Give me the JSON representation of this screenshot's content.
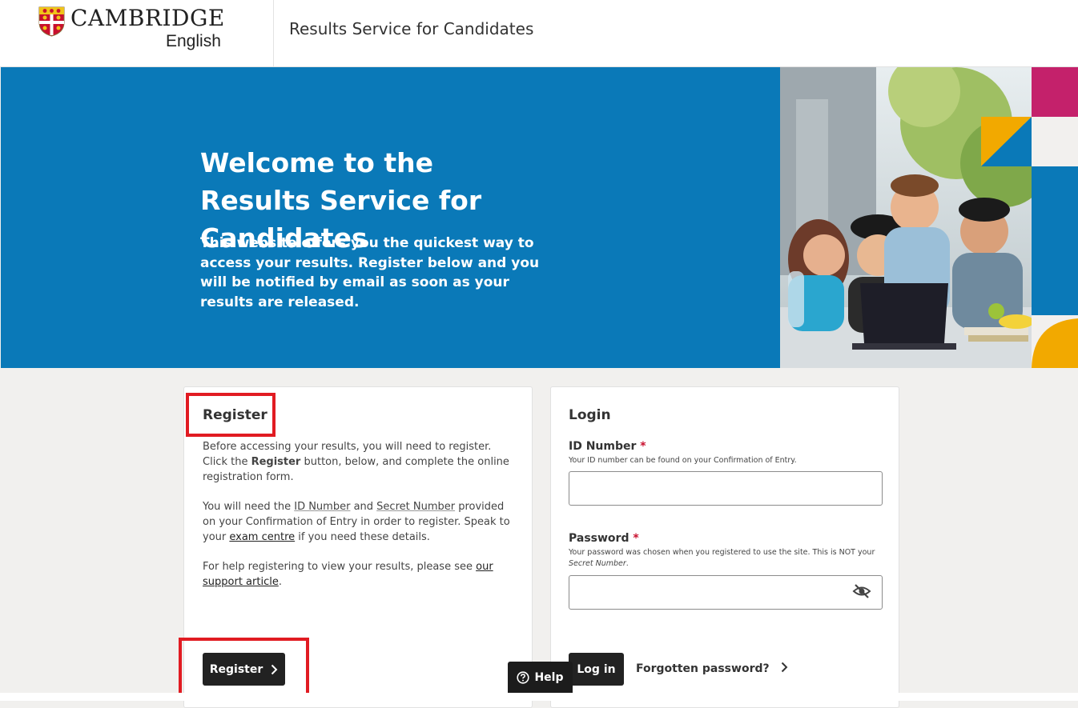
{
  "header": {
    "brand": "CAMBRIDGE",
    "brand_sub": "English",
    "title": "Results Service for Candidates",
    "logo_icon": "cambridge-crest-icon"
  },
  "hero": {
    "title": "Welcome to the Results Service for Candidates",
    "text": "This website offers you the quickest way to access your results. Register below and you will be notified by email as soon as your results are released."
  },
  "register": {
    "heading": "Register",
    "p1_a": "Before accessing your results, you will need to register. Click the ",
    "p1_bold": "Register",
    "p1_b": " button, below, and complete the online registration form.",
    "p2_a": "You will need the ",
    "p2_id": "ID Number",
    "p2_and": " and ",
    "p2_secret": "Secret Number",
    "p2_b": " provided on your Confirmation of Entry in order to register. Speak to your ",
    "p2_link": "exam centre",
    "p2_c": " if you need these details.",
    "p3_a": "For help registering to view your results, please see ",
    "p3_link": "our support article",
    "p3_b": ".",
    "button": "Register"
  },
  "login": {
    "heading": "Login",
    "id_label": "ID Number",
    "id_hint": "Your ID number can be found on your Confirmation of Entry.",
    "id_value": "",
    "password_label": "Password",
    "password_hint_a": "Your password was chosen when you registered to use the site. This is NOT your ",
    "password_hint_em": "Secret Number",
    "password_hint_b": ".",
    "password_value": "",
    "required_mark": "*",
    "button": "Log in",
    "forgot": "Forgotten password?"
  },
  "help": {
    "label": "Help"
  },
  "colors": {
    "hero_blue": "#0a79b8",
    "highlight_red": "#e11b22",
    "button_dark": "#222222",
    "accent_magenta": "#c4216b",
    "accent_yellow": "#f2a900"
  }
}
